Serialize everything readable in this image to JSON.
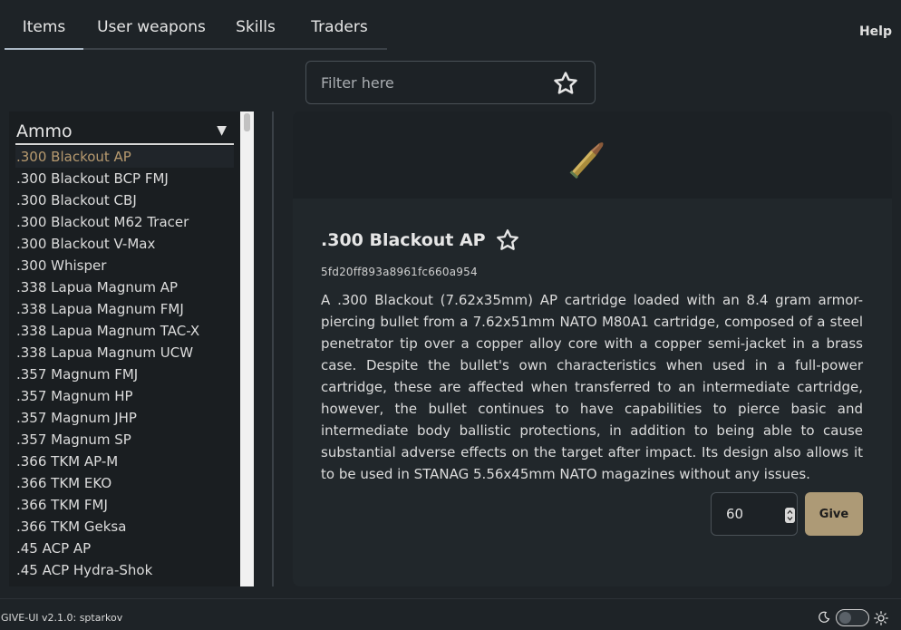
{
  "tabs": [
    "Items",
    "User weapons",
    "Skills",
    "Traders"
  ],
  "help_label": "Help",
  "filter": {
    "placeholder": "Filter here"
  },
  "category": {
    "selected": "Ammo"
  },
  "items": [
    ".300 Blackout AP",
    ".300 Blackout BCP FMJ",
    ".300 Blackout CBJ",
    ".300 Blackout M62 Tracer",
    ".300 Blackout V-Max",
    ".300 Whisper",
    ".338 Lapua Magnum AP",
    ".338 Lapua Magnum FMJ",
    ".338 Lapua Magnum TAC-X",
    ".338 Lapua Magnum UCW",
    ".357 Magnum FMJ",
    ".357 Magnum HP",
    ".357 Magnum JHP",
    ".357 Magnum SP",
    ".366 TKM AP-M",
    ".366 TKM EKO",
    ".366 TKM FMJ",
    ".366 TKM Geksa",
    ".45 ACP AP",
    ".45 ACP Hydra-Shok"
  ],
  "detail": {
    "title": ".300 Blackout AP",
    "id": "5fd20ff893a8961fc660a954",
    "description": "A .300 Blackout (7.62x35mm) AP cartridge loaded with an 8.4 gram armor-piercing bullet from a 7.62x51mm NATO M80A1 cartridge, composed of a steel penetrator tip over a copper alloy core with a copper semi-jacket in a brass case. Despite the bullet's own characteristics when used in a full-power cartridge, these are affected when transferred to an intermediate cartridge, however, the bullet continues to have capabilities to pierce basic and intermediate body ballistic protections, in addition to being able to cause substantial adverse effects on the target after impact. Its design also allows it to be used in STANAG 5.56x45mm NATO magazines without any issues.",
    "quantity": "60",
    "give_label": "Give"
  },
  "footer": {
    "version": "GIVE-UI v2.1.0: sptarkov"
  },
  "colors": {
    "accent": "#ad9a76",
    "selected_text": "#b79a6f",
    "background": "#1e2327"
  },
  "icons": {
    "filter_favorite": "star-outline-icon",
    "title_favorite": "star-outline-icon",
    "theme_dark": "moon-icon",
    "theme_light": "sun-icon"
  }
}
